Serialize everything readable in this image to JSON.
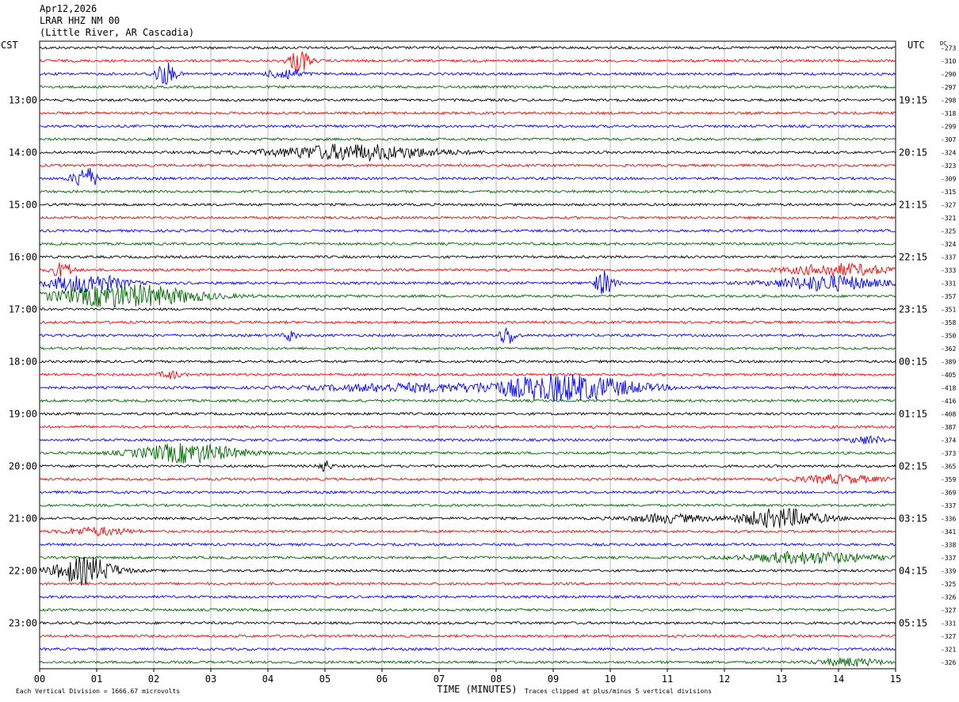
{
  "header": {
    "date": "Apr12,2026",
    "station": "LRAR HHZ NM 00",
    "location": "(Little River, AR Cascadia)"
  },
  "labels": {
    "left_tz": "CST",
    "right_tz": "UTC",
    "dc_header": "DC",
    "xlabel": "TIME (MINUTES)",
    "footer_left": "Each Vertical Division = 1666.67 microvolts",
    "footer_right": "Traces clipped at plus/minus 5 vertical divisions"
  },
  "chart_data": {
    "type": "line",
    "title": "LRAR HHZ NM 00 (Little River, AR Cascadia) Apr12,2026",
    "xlabel": "TIME (MINUTES)",
    "xlim": [
      0,
      15
    ],
    "x_ticks": [
      "00",
      "01",
      "02",
      "03",
      "04",
      "05",
      "06",
      "07",
      "08",
      "09",
      "10",
      "11",
      "12",
      "13",
      "14",
      "15"
    ],
    "trace_count": 48,
    "trace_colors": [
      "#000000",
      "#ff0000",
      "#0000ff",
      "#006600"
    ],
    "left_hour_labels": [
      "13:00",
      "14:00",
      "15:00",
      "16:00",
      "17:00",
      "18:00",
      "19:00",
      "20:00",
      "21:00",
      "22:00",
      "23:00"
    ],
    "right_hour_labels": [
      "19:15",
      "20:15",
      "21:15",
      "22:15",
      "23:15",
      "00:15",
      "01:15",
      "02:15",
      "03:15",
      "04:15",
      "05:15"
    ],
    "dc_offsets": [
      273,
      310,
      290,
      297,
      298,
      318,
      299,
      307,
      324,
      323,
      309,
      315,
      327,
      321,
      325,
      324,
      337,
      333,
      331,
      357,
      351,
      358,
      350,
      362,
      389,
      405,
      418,
      416,
      408,
      387,
      374,
      373,
      365,
      359,
      369,
      337,
      336,
      341,
      338,
      337,
      339,
      325,
      326,
      327,
      331,
      327,
      321,
      326
    ],
    "events": [
      {
        "trace": 1,
        "center_min": 4.55,
        "width_min": 0.5,
        "amplitude": 3.0
      },
      {
        "trace": 2,
        "center_min": 2.2,
        "width_min": 0.5,
        "amplitude": 3.0
      },
      {
        "trace": 2,
        "center_min": 4.3,
        "width_min": 0.8,
        "amplitude": 1.5
      },
      {
        "trace": 8,
        "center_min": 5.5,
        "width_min": 4.0,
        "amplitude": 2.0
      },
      {
        "trace": 10,
        "center_min": 0.8,
        "width_min": 0.6,
        "amplitude": 3.0
      },
      {
        "trace": 17,
        "center_min": 0.4,
        "width_min": 0.5,
        "amplitude": 2.0
      },
      {
        "trace": 17,
        "center_min": 14.0,
        "width_min": 2.5,
        "amplitude": 1.5
      },
      {
        "trace": 18,
        "center_min": 0.8,
        "width_min": 1.8,
        "amplitude": 2.5
      },
      {
        "trace": 18,
        "center_min": 9.9,
        "width_min": 0.5,
        "amplitude": 3.0
      },
      {
        "trace": 18,
        "center_min": 13.8,
        "width_min": 2.5,
        "amplitude": 2.0
      },
      {
        "trace": 19,
        "center_min": 1.5,
        "width_min": 3.5,
        "amplitude": 3.0
      },
      {
        "trace": 22,
        "center_min": 4.4,
        "width_min": 0.3,
        "amplitude": 1.5
      },
      {
        "trace": 22,
        "center_min": 8.2,
        "width_min": 0.4,
        "amplitude": 2.5
      },
      {
        "trace": 25,
        "center_min": 2.3,
        "width_min": 0.5,
        "amplitude": 1.0
      },
      {
        "trace": 26,
        "center_min": 9.2,
        "width_min": 3.5,
        "amplitude": 3.5
      },
      {
        "trace": 26,
        "center_min": 6.3,
        "width_min": 4.0,
        "amplitude": 1.0
      },
      {
        "trace": 30,
        "center_min": 14.5,
        "width_min": 0.8,
        "amplitude": 1.0
      },
      {
        "trace": 31,
        "center_min": 2.6,
        "width_min": 2.5,
        "amplitude": 2.5
      },
      {
        "trace": 32,
        "center_min": 5.0,
        "width_min": 0.3,
        "amplitude": 1.5
      },
      {
        "trace": 33,
        "center_min": 14.0,
        "width_min": 2.0,
        "amplitude": 1.0
      },
      {
        "trace": 36,
        "center_min": 13.0,
        "width_min": 2.0,
        "amplitude": 2.5
      },
      {
        "trace": 36,
        "center_min": 11.0,
        "width_min": 2.0,
        "amplitude": 1.0
      },
      {
        "trace": 37,
        "center_min": 1.0,
        "width_min": 1.5,
        "amplitude": 1.0
      },
      {
        "trace": 39,
        "center_min": 13.5,
        "width_min": 3.0,
        "amplitude": 1.5
      },
      {
        "trace": 40,
        "center_min": 0.8,
        "width_min": 1.5,
        "amplitude": 3.5
      },
      {
        "trace": 47,
        "center_min": 14.2,
        "width_min": 1.5,
        "amplitude": 1.0
      }
    ]
  }
}
